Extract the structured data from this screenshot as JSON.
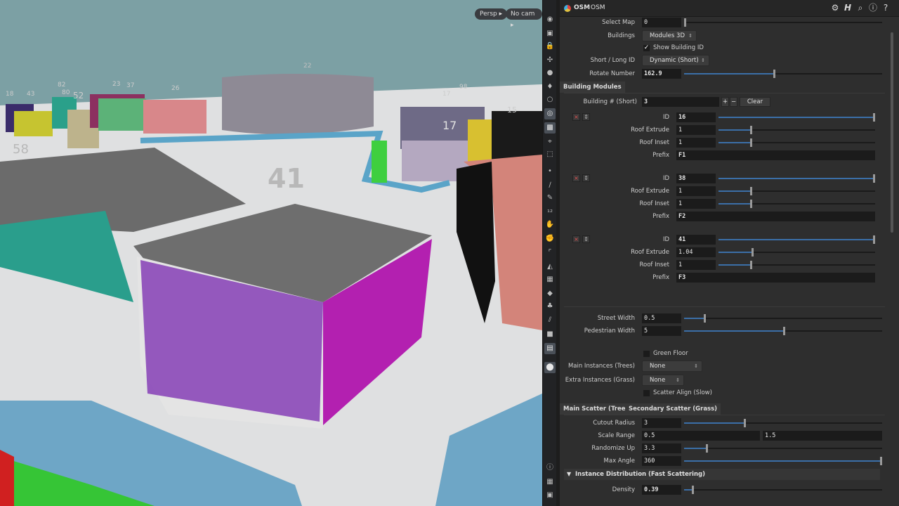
{
  "viewport": {
    "camera_mode": "Persp",
    "camera_name": "No cam",
    "building_labels": [
      "41",
      "17",
      "22",
      "58",
      "52",
      "82",
      "80",
      "23",
      "37",
      "26",
      "17",
      "98",
      "15",
      "43",
      "18"
    ]
  },
  "panel": {
    "node_type": "OSM",
    "node_name": "OSM"
  },
  "params": {
    "select_map": {
      "label": "Select Map",
      "value": "0",
      "level": 0.0
    },
    "buildings": {
      "label": "Buildings",
      "value": "Modules 3D"
    },
    "show_building_id": {
      "label": "Show Building ID",
      "checked": true
    },
    "short_long_id": {
      "label": "Short / Long ID",
      "value": "Dynamic (Short)"
    },
    "rotate_number": {
      "label": "Rotate Number",
      "value": "162.9",
      "level": 0.45
    }
  },
  "building_modules": {
    "tab_label": "Building Modules",
    "building_count": {
      "label": "Building # (Short)",
      "value": "3",
      "add": "+",
      "remove": "−",
      "clear": "Clear"
    },
    "field_labels": {
      "id": "ID",
      "roof_extrude": "Roof Extrude",
      "roof_inset": "Roof Inset",
      "prefix": "Prefix"
    },
    "instance_buttons": {
      "remove": "×",
      "move": "⇕"
    },
    "modules": [
      {
        "id": "16",
        "roof_extrude": "1",
        "roof_inset": "1",
        "prefix": "F1",
        "id_level": 1.0,
        "extrude_level": 0.2,
        "inset_level": 0.2
      },
      {
        "id": "38",
        "roof_extrude": "1",
        "roof_inset": "1",
        "prefix": "F2",
        "id_level": 1.0,
        "extrude_level": 0.2,
        "inset_level": 0.2
      },
      {
        "id": "41",
        "roof_extrude": "1.04",
        "roof_inset": "1",
        "prefix": "F3",
        "id_level": 1.0,
        "extrude_level": 0.21,
        "inset_level": 0.2
      }
    ]
  },
  "streets": {
    "street_width": {
      "label": "Street Width",
      "value": "0.5",
      "level": 0.1
    },
    "pedestrian_width": {
      "label": "Pedestrian Width",
      "value": "5",
      "level": 0.5
    }
  },
  "instances": {
    "green_floor": {
      "label": "Green Floor",
      "checked": false
    },
    "main_instances": {
      "label": "Main Instances (Trees)",
      "value": "None"
    },
    "extra_instances": {
      "label": "Extra Instances (Grass)",
      "value": "None"
    },
    "scatter_align": {
      "label": "Scatter Align (Slow)",
      "checked": false
    }
  },
  "scatter_tabs": {
    "main": "Main Scatter (Trees)",
    "secondary": "Secondary Scatter (Grass)"
  },
  "scatter": {
    "cutout_radius": {
      "label": "Cutout Radius",
      "value": "3",
      "level": 0.3
    },
    "scale_range": {
      "label": "Scale Range",
      "min": "0.5",
      "max": "1.5"
    },
    "randomize_up": {
      "label": "Randomize Up",
      "value": "3.3",
      "level": 0.11
    },
    "max_angle": {
      "label": "Max Angle",
      "value": "360",
      "level": 1.0
    }
  },
  "instance_distribution": {
    "folder_label": "Instance Distribution (Fast Scattering)",
    "density": {
      "label": "Density",
      "value": "0.39",
      "level": 0.04
    }
  },
  "icons": {
    "header": [
      "gear-icon",
      "houdini-h-icon",
      "search-icon",
      "info-icon",
      "help-icon"
    ]
  }
}
